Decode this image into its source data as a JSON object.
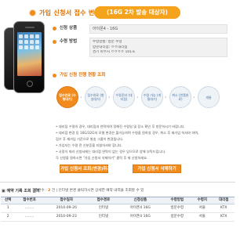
{
  "header": {
    "title": "가입 신청서 접수 번호",
    "badge": "(16G 2차 발송 대상자)"
  },
  "form": {
    "product_label": "신청 상품",
    "product_value": "아이폰4 - 16G",
    "method_label": "수령 방법",
    "method_lines": [
      "수령방법: 방문 수령",
      "방문대리점: ㅇㅇ대리점",
      "경기 파주시 ㅇㅇㅇㅇ 101호"
    ],
    "steps_title": "가입 신청 진행 현황 조회"
  },
  "steps": [
    {
      "label": "접수완료 (수령대기)",
      "active": true
    },
    {
      "label": "접수완료 (발송대기)",
      "active": false
    },
    {
      "label": "수령준비 (대리점)",
      "active": false
    },
    {
      "label": "수령 가능 (개통대기)",
      "active": false
    },
    {
      "label": "취소 (반품완료)",
      "active": false
    },
    {
      "label": "개통",
      "active": false
    }
  ],
  "notes": [
    "• 대리점 수령의 경우, 대리점과 연락하여 정해진 수령일 및 장소 확인 후 방문하시기 바랍니다.",
    "• 대리점 변경 등 16G/32G의 모델 변경은 불가능하며 수령을 원하실 경우, 취소 후 재가입 하셔야 하며,",
    "  접수 후 재가입 기준으로 발송 그룹이 변경됩니다.",
    "• 가입자는 수령 전 신분증을 지참하셔야 합니다.",
    "• 사정이 따라 신청서에는 대리점 연락이 없는 경우 있으므로 양해 부탁드립니다.",
    "  각 신청을 원하시면 \"가입 신청서 삭제하기\" 클릭 후 재 신청하세요."
  ],
  "buttons": {
    "edit": "가입 신청서 조회(변경)하기",
    "delete": "가입 신청서 삭제하기"
  },
  "results": {
    "title": "▣ 예약 기록 조회 결과",
    "summary_prefix": "총건수 :",
    "summary_count": "2",
    "summary_suffix": "건 | 인터넷 변경 클릭하시면 상세한 예약 내역을 조회할 수 있",
    "columns": [
      "선택",
      "접수번호",
      "접수일자",
      "접수경로",
      "신청상품",
      "수령방법",
      "수령지",
      "대리점"
    ],
    "rows": [
      [
        "1",
        "........",
        "2010-09-20",
        "인터넷",
        "아이폰4 16G",
        "방문수령",
        "서울",
        "KTX"
      ],
      [
        "2",
        "........",
        "2010-09-23",
        "인터넷",
        "아이폰4 16G",
        "방문수령",
        "서울",
        "KTX"
      ]
    ]
  },
  "colors": {
    "accent": "#f28b1e",
    "accent_dark": "#e06f00"
  }
}
